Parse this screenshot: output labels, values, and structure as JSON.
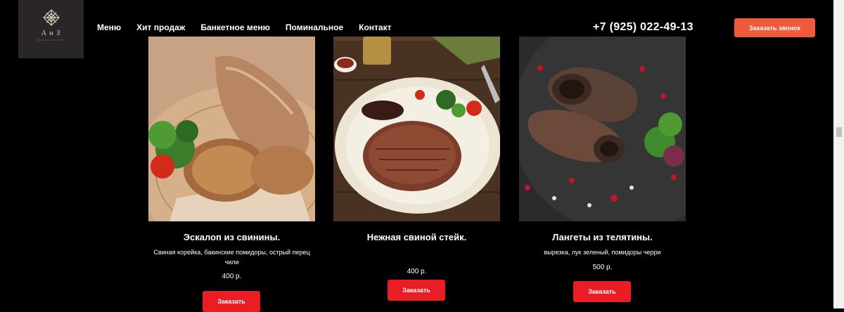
{
  "header": {
    "logo": {
      "title": "А и З",
      "subtitle": "ТРАПЕЗНАЯ ЗАЛА"
    },
    "nav": [
      "Меню",
      "Хит продаж",
      "Банкетное меню",
      "Поминальное",
      "Контакт"
    ],
    "phone": "+7 (925) 022-49-13",
    "call_button": "Заказать звонок"
  },
  "products": [
    {
      "title": "Эскалоп из свинины.",
      "description": "Свиная корейка, бакинские помидоры, острый перец чили",
      "price": "400 р.",
      "button": "Заказать",
      "image_icon": "pork-escalope-photo"
    },
    {
      "title": "Нежная свиной стейк.",
      "description": "",
      "price": "400 р.",
      "button": "Заказать",
      "image_icon": "pork-steak-photo"
    },
    {
      "title": "Лангеты из телятины.",
      "description": "вырезка, лук зеленый, помидоры черри",
      "price": "500 р.",
      "button": "Заказать",
      "image_icon": "veal-rolls-photo"
    }
  ],
  "colors": {
    "background": "#000000",
    "call_button": "#ef5a3b",
    "order_button": "#ea1c24"
  }
}
